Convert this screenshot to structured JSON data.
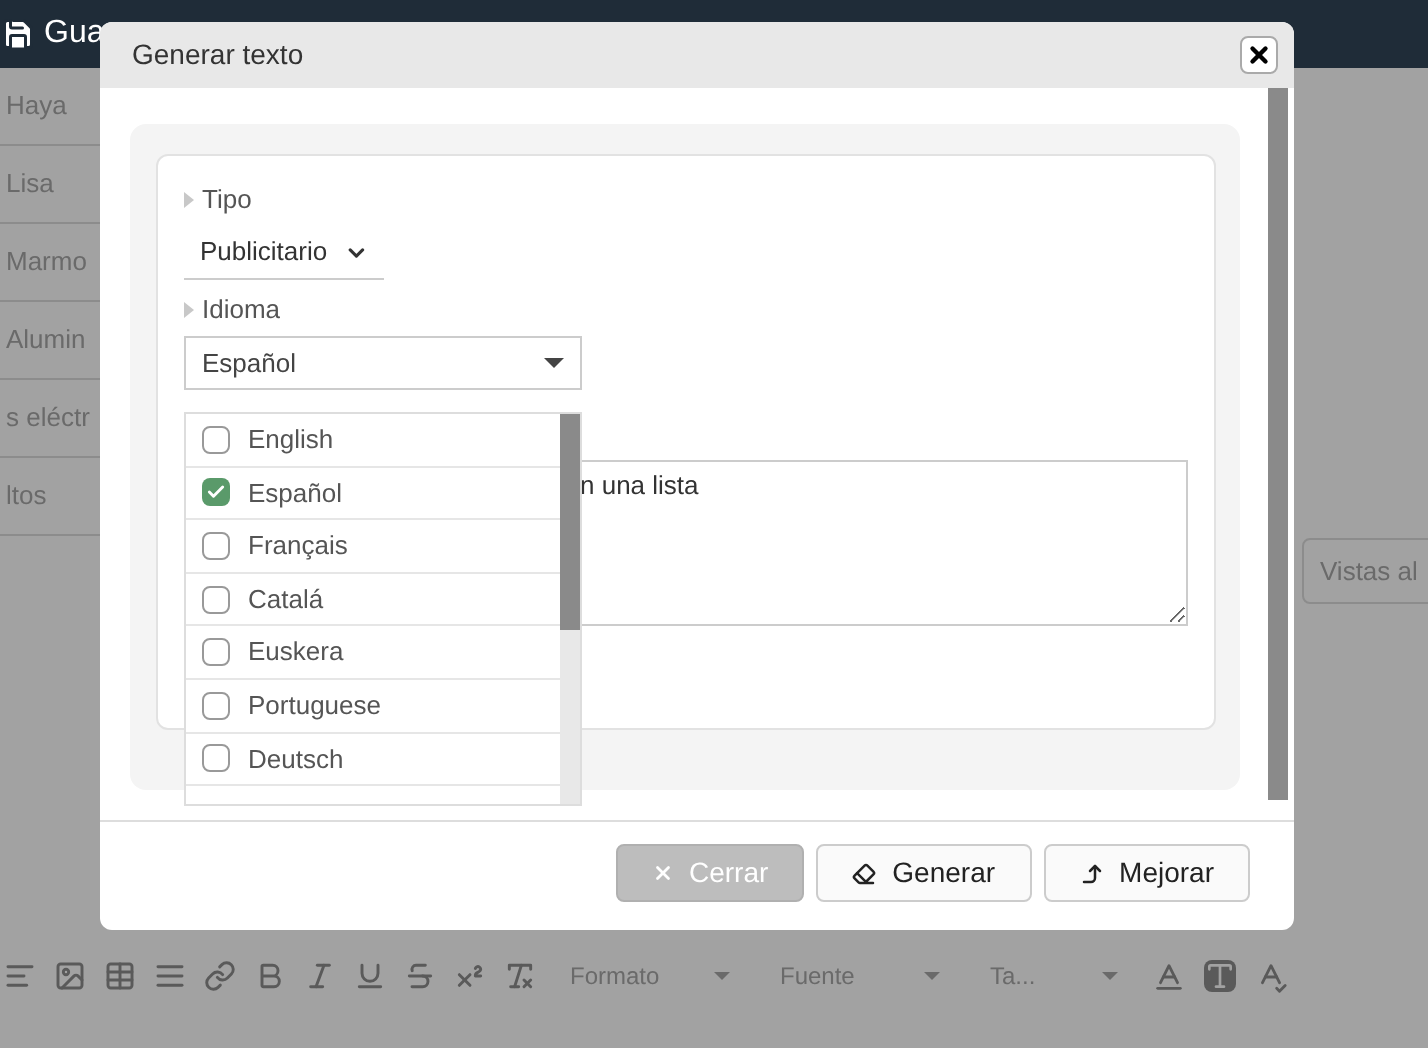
{
  "page": {
    "top_bar": {
      "title": "Gua"
    },
    "list_items": [
      "Haya",
      "Lisa",
      "Marmo",
      "Alumin",
      "s eléctr",
      "ltos"
    ],
    "side_button": "Vistas al",
    "toolbar": {
      "dropdowns": [
        "Formato",
        "Fuente",
        "Ta..."
      ]
    }
  },
  "dialog": {
    "title": "Generar texto",
    "tipo": {
      "label": "Tipo",
      "value": "Publicitario"
    },
    "idioma": {
      "label": "Idioma",
      "value": "Español",
      "expanded": true,
      "options": [
        {
          "label": "English",
          "checked": false
        },
        {
          "label": "Español",
          "checked": true
        },
        {
          "label": "Français",
          "checked": false
        },
        {
          "label": "Catalá",
          "checked": false
        },
        {
          "label": "Euskera",
          "checked": false
        },
        {
          "label": "Portuguese",
          "checked": false
        },
        {
          "label": "Deutsch",
          "checked": false
        }
      ]
    },
    "text_value": "n una lista",
    "buttons": [
      {
        "kind": "close",
        "label": "Cerrar",
        "disabled": true
      },
      {
        "kind": "generate",
        "label": "Generar",
        "disabled": false
      },
      {
        "kind": "improve",
        "label": "Mejorar",
        "disabled": false
      }
    ]
  }
}
